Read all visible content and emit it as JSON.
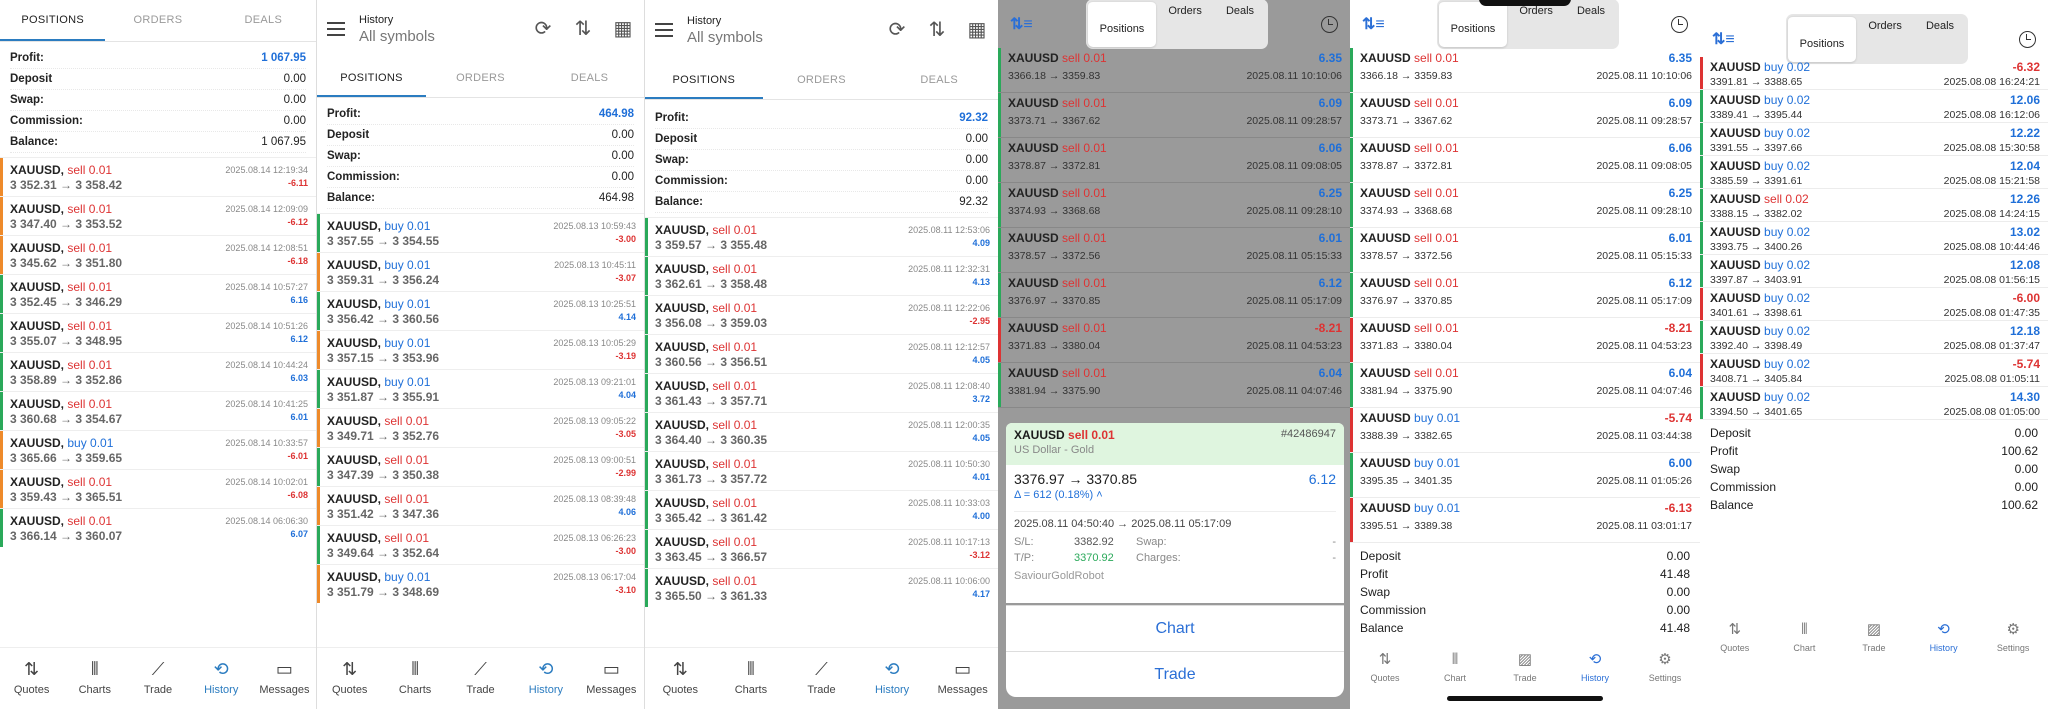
{
  "labels": {
    "chart": "Chart",
    "trade": "Trade"
  },
  "p1": {
    "tabs": [
      "POSITIONS",
      "ORDERS",
      "DEALS"
    ],
    "summary": [
      [
        "Profit:",
        "1 067.95"
      ],
      [
        "Deposit",
        "0.00"
      ],
      [
        "Swap:",
        "0.00"
      ],
      [
        "Commission:",
        "0.00"
      ],
      [
        "Balance:",
        "1 067.95"
      ]
    ],
    "trades": [
      {
        "sym": "XAUUSD,",
        "side": "sell 0.01",
        "type": "sell",
        "date": "2025.08.14 12:19:34",
        "px": "3 352.31 → 3 358.42",
        "pl": "-6.11",
        "neg": true
      },
      {
        "sym": "XAUUSD,",
        "side": "sell 0.01",
        "type": "sell",
        "date": "2025.08.14 12:09:09",
        "px": "3 347.40 → 3 353.52",
        "pl": "-6.12",
        "neg": true
      },
      {
        "sym": "XAUUSD,",
        "side": "sell 0.01",
        "type": "sell",
        "date": "2025.08.14 12:08:51",
        "px": "3 345.62 → 3 351.80",
        "pl": "-6.18",
        "neg": true
      },
      {
        "sym": "XAUUSD,",
        "side": "sell 0.01",
        "type": "sell",
        "date": "2025.08.14 10:57:27",
        "px": "3 352.45 → 3 346.29",
        "pl": "6.16",
        "neg": false
      },
      {
        "sym": "XAUUSD,",
        "side": "sell 0.01",
        "type": "sell",
        "date": "2025.08.14 10:51:26",
        "px": "3 355.07 → 3 348.95",
        "pl": "6.12",
        "neg": false
      },
      {
        "sym": "XAUUSD,",
        "side": "sell 0.01",
        "type": "sell",
        "date": "2025.08.14 10:44:24",
        "px": "3 358.89 → 3 352.86",
        "pl": "6.03",
        "neg": false
      },
      {
        "sym": "XAUUSD,",
        "side": "sell 0.01",
        "type": "sell",
        "date": "2025.08.14 10:41:25",
        "px": "3 360.68 → 3 354.67",
        "pl": "6.01",
        "neg": false
      },
      {
        "sym": "XAUUSD,",
        "side": "buy 0.01",
        "type": "buy",
        "date": "2025.08.14 10:33:57",
        "px": "3 365.66 → 3 359.65",
        "pl": "-6.01",
        "neg": true
      },
      {
        "sym": "XAUUSD,",
        "side": "sell 0.01",
        "type": "sell",
        "date": "2025.08.14 10:02:01",
        "px": "3 359.43 → 3 365.51",
        "pl": "-6.08",
        "neg": true
      },
      {
        "sym": "XAUUSD,",
        "side": "sell 0.01",
        "type": "sell",
        "date": "2025.08.14 06:06:30",
        "px": "3 366.14 → 3 360.07",
        "pl": "6.07",
        "neg": false
      }
    ],
    "nav": [
      "Quotes",
      "Charts",
      "Trade",
      "History",
      "Messages"
    ]
  },
  "p2": {
    "header": {
      "title": "History",
      "subtitle": "All symbols"
    },
    "tabs": [
      "POSITIONS",
      "ORDERS",
      "DEALS"
    ],
    "summary": [
      [
        "Profit:",
        "464.98"
      ],
      [
        "Deposit",
        "0.00"
      ],
      [
        "Swap:",
        "0.00"
      ],
      [
        "Commission:",
        "0.00"
      ],
      [
        "Balance:",
        "464.98"
      ]
    ],
    "trades": [
      {
        "sym": "XAUUSD,",
        "side": "buy 0.01",
        "type": "buy",
        "date": "2025.08.13 10:59:43",
        "px": "3 357.55 → 3 354.55",
        "pl": "-3.00",
        "neg": true
      },
      {
        "sym": "XAUUSD,",
        "side": "buy 0.01",
        "type": "buy",
        "date": "2025.08.13 10:45:11",
        "px": "3 359.31 → 3 356.24",
        "pl": "-3.07",
        "neg": true
      },
      {
        "sym": "XAUUSD,",
        "side": "buy 0.01",
        "type": "buy",
        "date": "2025.08.13 10:25:51",
        "px": "3 356.42 → 3 360.56",
        "pl": "4.14",
        "neg": false
      },
      {
        "sym": "XAUUSD,",
        "side": "buy 0.01",
        "type": "buy",
        "date": "2025.08.13 10:05:29",
        "px": "3 357.15 → 3 353.96",
        "pl": "-3.19",
        "neg": true
      },
      {
        "sym": "XAUUSD,",
        "side": "buy 0.01",
        "type": "buy",
        "date": "2025.08.13 09:21:01",
        "px": "3 351.87 → 3 355.91",
        "pl": "4.04",
        "neg": false
      },
      {
        "sym": "XAUUSD,",
        "side": "sell 0.01",
        "type": "sell",
        "date": "2025.08.13 09:05:22",
        "px": "3 349.71 → 3 352.76",
        "pl": "-3.05",
        "neg": true
      },
      {
        "sym": "XAUUSD,",
        "side": "sell 0.01",
        "type": "sell",
        "date": "2025.08.13 09:00:51",
        "px": "3 347.39 → 3 350.38",
        "pl": "-2.99",
        "neg": true
      },
      {
        "sym": "XAUUSD,",
        "side": "sell 0.01",
        "type": "sell",
        "date": "2025.08.13 08:39:48",
        "px": "3 351.42 → 3 347.36",
        "pl": "4.06",
        "neg": false
      },
      {
        "sym": "XAUUSD,",
        "side": "sell 0.01",
        "type": "sell",
        "date": "2025.08.13 06:26:23",
        "px": "3 349.64 → 3 352.64",
        "pl": "-3.00",
        "neg": true
      },
      {
        "sym": "XAUUSD,",
        "side": "buy 0.01",
        "type": "buy",
        "date": "2025.08.13 06:17:04",
        "px": "3 351.79 → 3 348.69",
        "pl": "-3.10",
        "neg": true
      }
    ],
    "nav": [
      "Quotes",
      "Charts",
      "Trade",
      "History",
      "Messages"
    ]
  },
  "p3": {
    "header": {
      "title": "History",
      "subtitle": "All symbols"
    },
    "tabs": [
      "POSITIONS",
      "ORDERS",
      "DEALS"
    ],
    "summary": [
      [
        "Profit:",
        "92.32"
      ],
      [
        "Deposit",
        "0.00"
      ],
      [
        "Swap:",
        "0.00"
      ],
      [
        "Commission:",
        "0.00"
      ],
      [
        "Balance:",
        "92.32"
      ]
    ],
    "trades": [
      {
        "sym": "XAUUSD,",
        "side": "sell 0.01",
        "type": "sell",
        "date": "2025.08.11 12:53:06",
        "px": "3 359.57 → 3 355.48",
        "pl": "4.09",
        "neg": false
      },
      {
        "sym": "XAUUSD,",
        "side": "sell 0.01",
        "type": "sell",
        "date": "2025.08.11 12:32:31",
        "px": "3 362.61 → 3 358.48",
        "pl": "4.13",
        "neg": false
      },
      {
        "sym": "XAUUSD,",
        "side": "sell 0.01",
        "type": "sell",
        "date": "2025.08.11 12:22:06",
        "px": "3 356.08 → 3 359.03",
        "pl": "-2.95",
        "neg": true
      },
      {
        "sym": "XAUUSD,",
        "side": "sell 0.01",
        "type": "sell",
        "date": "2025.08.11 12:12:57",
        "px": "3 360.56 → 3 356.51",
        "pl": "4.05",
        "neg": false
      },
      {
        "sym": "XAUUSD,",
        "side": "sell 0.01",
        "type": "sell",
        "date": "2025.08.11 12:08:40",
        "px": "3 361.43 → 3 357.71",
        "pl": "3.72",
        "neg": false
      },
      {
        "sym": "XAUUSD,",
        "side": "sell 0.01",
        "type": "sell",
        "date": "2025.08.11 12:00:35",
        "px": "3 364.40 → 3 360.35",
        "pl": "4.05",
        "neg": false
      },
      {
        "sym": "XAUUSD,",
        "side": "sell 0.01",
        "type": "sell",
        "date": "2025.08.11 10:50:30",
        "px": "3 361.73 → 3 357.72",
        "pl": "4.01",
        "neg": false
      },
      {
        "sym": "XAUUSD,",
        "side": "sell 0.01",
        "type": "sell",
        "date": "2025.08.11 10:33:03",
        "px": "3 365.42 → 3 361.42",
        "pl": "4.00",
        "neg": false
      },
      {
        "sym": "XAUUSD,",
        "side": "sell 0.01",
        "type": "sell",
        "date": "2025.08.11 10:17:13",
        "px": "3 363.45 → 3 366.57",
        "pl": "-3.12",
        "neg": true
      },
      {
        "sym": "XAUUSD,",
        "side": "sell 0.01",
        "type": "sell",
        "date": "2025.08.11 10:06:00",
        "px": "3 365.50 → 3 361.33",
        "pl": "4.17",
        "neg": false
      }
    ],
    "nav": [
      "Quotes",
      "Charts",
      "Trade",
      "History",
      "Messages"
    ]
  },
  "p4": {
    "seg": [
      "Positions",
      "Orders",
      "Deals"
    ],
    "trades": [
      {
        "sym": "XAUUSD",
        "side": "sell 0.01",
        "type": "sell",
        "pl": "6.35",
        "neg": false,
        "px": "3366.18 → 3359.83",
        "date": "2025.08.11 10:10:06"
      },
      {
        "sym": "XAUUSD",
        "side": "sell 0.01",
        "type": "sell",
        "pl": "6.09",
        "neg": false,
        "px": "3373.71 → 3367.62",
        "date": "2025.08.11 09:28:57"
      },
      {
        "sym": "XAUUSD",
        "side": "sell 0.01",
        "type": "sell",
        "pl": "6.06",
        "neg": false,
        "px": "3378.87 → 3372.81",
        "date": "2025.08.11 09:08:05"
      },
      {
        "sym": "XAUUSD",
        "side": "sell 0.01",
        "type": "sell",
        "pl": "6.25",
        "neg": false,
        "px": "3374.93 → 3368.68",
        "date": "2025.08.11 09:28:10"
      },
      {
        "sym": "XAUUSD",
        "side": "sell 0.01",
        "type": "sell",
        "pl": "6.01",
        "neg": false,
        "px": "3378.57 → 3372.56",
        "date": "2025.08.11 05:15:33"
      },
      {
        "sym": "XAUUSD",
        "side": "sell 0.01",
        "type": "sell",
        "pl": "6.12",
        "neg": false,
        "px": "3376.97 → 3370.85",
        "date": "2025.08.11 05:17:09"
      },
      {
        "sym": "XAUUSD",
        "side": "sell 0.01",
        "type": "sell",
        "pl": "-8.21",
        "neg": true,
        "px": "3371.83 → 3380.04",
        "date": "2025.08.11 04:53:23"
      },
      {
        "sym": "XAUUSD",
        "side": "sell 0.01",
        "type": "sell",
        "pl": "6.04",
        "neg": false,
        "px": "3381.94 → 3375.90",
        "date": "2025.08.11 04:07:46"
      }
    ],
    "detail": {
      "sym": "XAUUSD",
      "side": "sell 0.01",
      "ticket": "#42486947",
      "desc": "US Dollar - Gold",
      "px": "3376.97 → 3370.85",
      "pl": "6.12",
      "delta": "Δ = 612 (0.18%) ˄",
      "times": "2025.08.11 04:50:40 → 2025.08.11 05:17:09",
      "sl_l": "S/L:",
      "sl": "3382.92",
      "tp_l": "T/P:",
      "tp": "3370.92",
      "swap_l": "Swap:",
      "swap": "-",
      "chg_l": "Charges:",
      "chg": "-",
      "comment": "SaviourGoldRobot"
    }
  },
  "p5": {
    "seg": [
      "Positions",
      "Orders",
      "Deals"
    ],
    "trades": [
      {
        "sym": "XAUUSD",
        "side": "sell 0.01",
        "type": "sell",
        "pl": "6.35",
        "neg": false,
        "px": "3366.18 → 3359.83",
        "date": "2025.08.11 10:10:06"
      },
      {
        "sym": "XAUUSD",
        "side": "sell 0.01",
        "type": "sell",
        "pl": "6.09",
        "neg": false,
        "px": "3373.71 → 3367.62",
        "date": "2025.08.11 09:28:57"
      },
      {
        "sym": "XAUUSD",
        "side": "sell 0.01",
        "type": "sell",
        "pl": "6.06",
        "neg": false,
        "px": "3378.87 → 3372.81",
        "date": "2025.08.11 09:08:05"
      },
      {
        "sym": "XAUUSD",
        "side": "sell 0.01",
        "type": "sell",
        "pl": "6.25",
        "neg": false,
        "px": "3374.93 → 3368.68",
        "date": "2025.08.11 09:28:10"
      },
      {
        "sym": "XAUUSD",
        "side": "sell 0.01",
        "type": "sell",
        "pl": "6.01",
        "neg": false,
        "px": "3378.57 → 3372.56",
        "date": "2025.08.11 05:15:33"
      },
      {
        "sym": "XAUUSD",
        "side": "sell 0.01",
        "type": "sell",
        "pl": "6.12",
        "neg": false,
        "px": "3376.97 → 3370.85",
        "date": "2025.08.11 05:17:09"
      },
      {
        "sym": "XAUUSD",
        "side": "sell 0.01",
        "type": "sell",
        "pl": "-8.21",
        "neg": true,
        "px": "3371.83 → 3380.04",
        "date": "2025.08.11 04:53:23"
      },
      {
        "sym": "XAUUSD",
        "side": "sell 0.01",
        "type": "sell",
        "pl": "6.04",
        "neg": false,
        "px": "3381.94 → 3375.90",
        "date": "2025.08.11 04:07:46"
      },
      {
        "sym": "XAUUSD",
        "side": "buy 0.01",
        "type": "buy",
        "pl": "-5.74",
        "neg": true,
        "px": "3388.39 → 3382.65",
        "date": "2025.08.11 03:44:38"
      },
      {
        "sym": "XAUUSD",
        "side": "buy 0.01",
        "type": "buy",
        "pl": "6.00",
        "neg": false,
        "px": "3395.35 → 3401.35",
        "date": "2025.08.11 01:05:26"
      },
      {
        "sym": "XAUUSD",
        "side": "buy 0.01",
        "type": "buy",
        "pl": "-6.13",
        "neg": true,
        "px": "3395.51 → 3389.38",
        "date": "2025.08.11 03:01:17"
      }
    ],
    "summary": [
      [
        "Deposit",
        "0.00"
      ],
      [
        "Profit",
        "41.48"
      ],
      [
        "Swap",
        "0.00"
      ],
      [
        "Commission",
        "0.00"
      ],
      [
        "Balance",
        "41.48"
      ]
    ],
    "nav": [
      "Quotes",
      "Chart",
      "Trade",
      "History",
      "Settings"
    ]
  },
  "p6": {
    "seg": [
      "Positions",
      "Orders",
      "Deals"
    ],
    "trades": [
      {
        "sym": "XAUUSD",
        "side": "buy 0.02",
        "type": "buy",
        "pl": "-6.32",
        "neg": true,
        "px": "3391.81 → 3388.65",
        "date": "2025.08.08 16:24:21"
      },
      {
        "sym": "XAUUSD",
        "side": "buy 0.02",
        "type": "buy",
        "pl": "12.06",
        "neg": false,
        "px": "3389.41 → 3395.44",
        "date": "2025.08.08 16:12:06"
      },
      {
        "sym": "XAUUSD",
        "side": "buy 0.02",
        "type": "buy",
        "pl": "12.22",
        "neg": false,
        "px": "3391.55 → 3397.66",
        "date": "2025.08.08 15:30:58"
      },
      {
        "sym": "XAUUSD",
        "side": "buy 0.02",
        "type": "buy",
        "pl": "12.04",
        "neg": false,
        "px": "3385.59 → 3391.61",
        "date": "2025.08.08 15:21:58"
      },
      {
        "sym": "XAUUSD",
        "side": "sell 0.02",
        "type": "sell",
        "pl": "12.26",
        "neg": false,
        "px": "3388.15 → 3382.02",
        "date": "2025.08.08 14:24:15"
      },
      {
        "sym": "XAUUSD",
        "side": "buy 0.02",
        "type": "buy",
        "pl": "13.02",
        "neg": false,
        "px": "3393.75 → 3400.26",
        "date": "2025.08.08 10:44:46"
      },
      {
        "sym": "XAUUSD",
        "side": "buy 0.02",
        "type": "buy",
        "pl": "12.08",
        "neg": false,
        "px": "3397.87 → 3403.91",
        "date": "2025.08.08 01:56:15"
      },
      {
        "sym": "XAUUSD",
        "side": "buy 0.02",
        "type": "buy",
        "pl": "-6.00",
        "neg": true,
        "px": "3401.61 → 3398.61",
        "date": "2025.08.08 01:47:35"
      },
      {
        "sym": "XAUUSD",
        "side": "buy 0.02",
        "type": "buy",
        "pl": "12.18",
        "neg": false,
        "px": "3392.40 → 3398.49",
        "date": "2025.08.08 01:37:47"
      },
      {
        "sym": "XAUUSD",
        "side": "buy 0.02",
        "type": "buy",
        "pl": "-5.74",
        "neg": true,
        "px": "3408.71 → 3405.84",
        "date": "2025.08.08 01:05:11"
      },
      {
        "sym": "XAUUSD",
        "side": "buy 0.02",
        "type": "buy",
        "pl": "14.30",
        "neg": false,
        "px": "3394.50 → 3401.65",
        "date": "2025.08.08 01:05:00"
      }
    ],
    "summary": [
      [
        "Deposit",
        "0.00"
      ],
      [
        "Profit",
        "100.62"
      ],
      [
        "Swap",
        "0.00"
      ],
      [
        "Commission",
        "0.00"
      ],
      [
        "Balance",
        "100.62"
      ]
    ],
    "nav": [
      "Quotes",
      "Chart",
      "Trade",
      "History",
      "Settings"
    ]
  }
}
